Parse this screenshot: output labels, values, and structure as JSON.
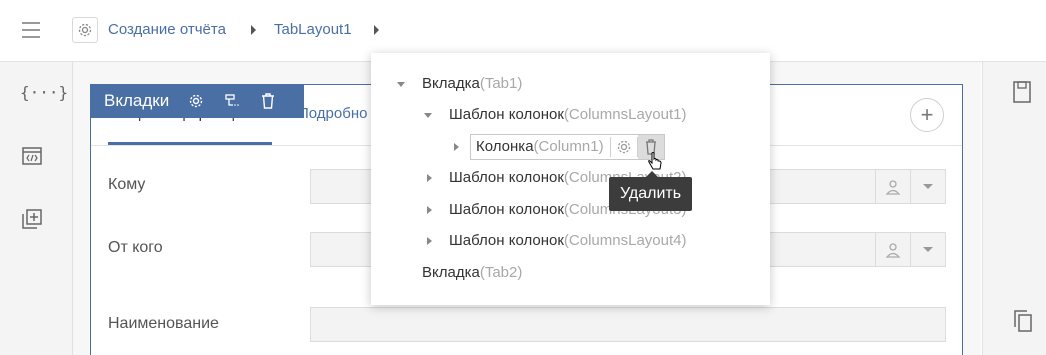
{
  "breadcrumb": {
    "items": [
      "Создание отчёта",
      "TabLayout1"
    ]
  },
  "component_toolbar": {
    "title": "Вкладки"
  },
  "tabs": [
    {
      "label": "Общая информация"
    },
    {
      "label": "Подробно"
    }
  ],
  "fields": [
    {
      "label": "Кому",
      "value": ""
    },
    {
      "label": "От кого",
      "value": ""
    },
    {
      "label": "Наименование",
      "value": ""
    }
  ],
  "tree": {
    "tab1": {
      "name": "Вкладка",
      "hint": "(Tab1)"
    },
    "layout1": {
      "name": "Шаблон колонок",
      "hint": "(ColumnsLayout1)"
    },
    "column1": {
      "name": "Колонка",
      "hint": "(Column1)"
    },
    "layout2": {
      "name": "Шаблон колонок",
      "hint": "(ColumnsLayout2)"
    },
    "layout3": {
      "name": "Шаблон колонок",
      "hint": "(ColumnsLayout3)"
    },
    "layout4": {
      "name": "Шаблон колонок",
      "hint": "(ColumnsLayout4)"
    },
    "tab2": {
      "name": "Вкладка",
      "hint": "(Tab2)"
    }
  },
  "tooltip": {
    "text": "Удалить"
  },
  "colors": {
    "accent": "#4a6fa5",
    "tooltip_bg": "#3c3c3c",
    "hint_text": "#a8a8a8"
  },
  "icons": {
    "menu": "hamburger-icon",
    "settings": "gear-icon",
    "delete": "trash-icon",
    "code": "braces-icon",
    "html": "code-window-icon",
    "add_component": "add-square-icon",
    "save": "floppy-icon",
    "copy": "copy-icon",
    "user": "user-icon",
    "cursor": "hand-pointer-icon"
  }
}
